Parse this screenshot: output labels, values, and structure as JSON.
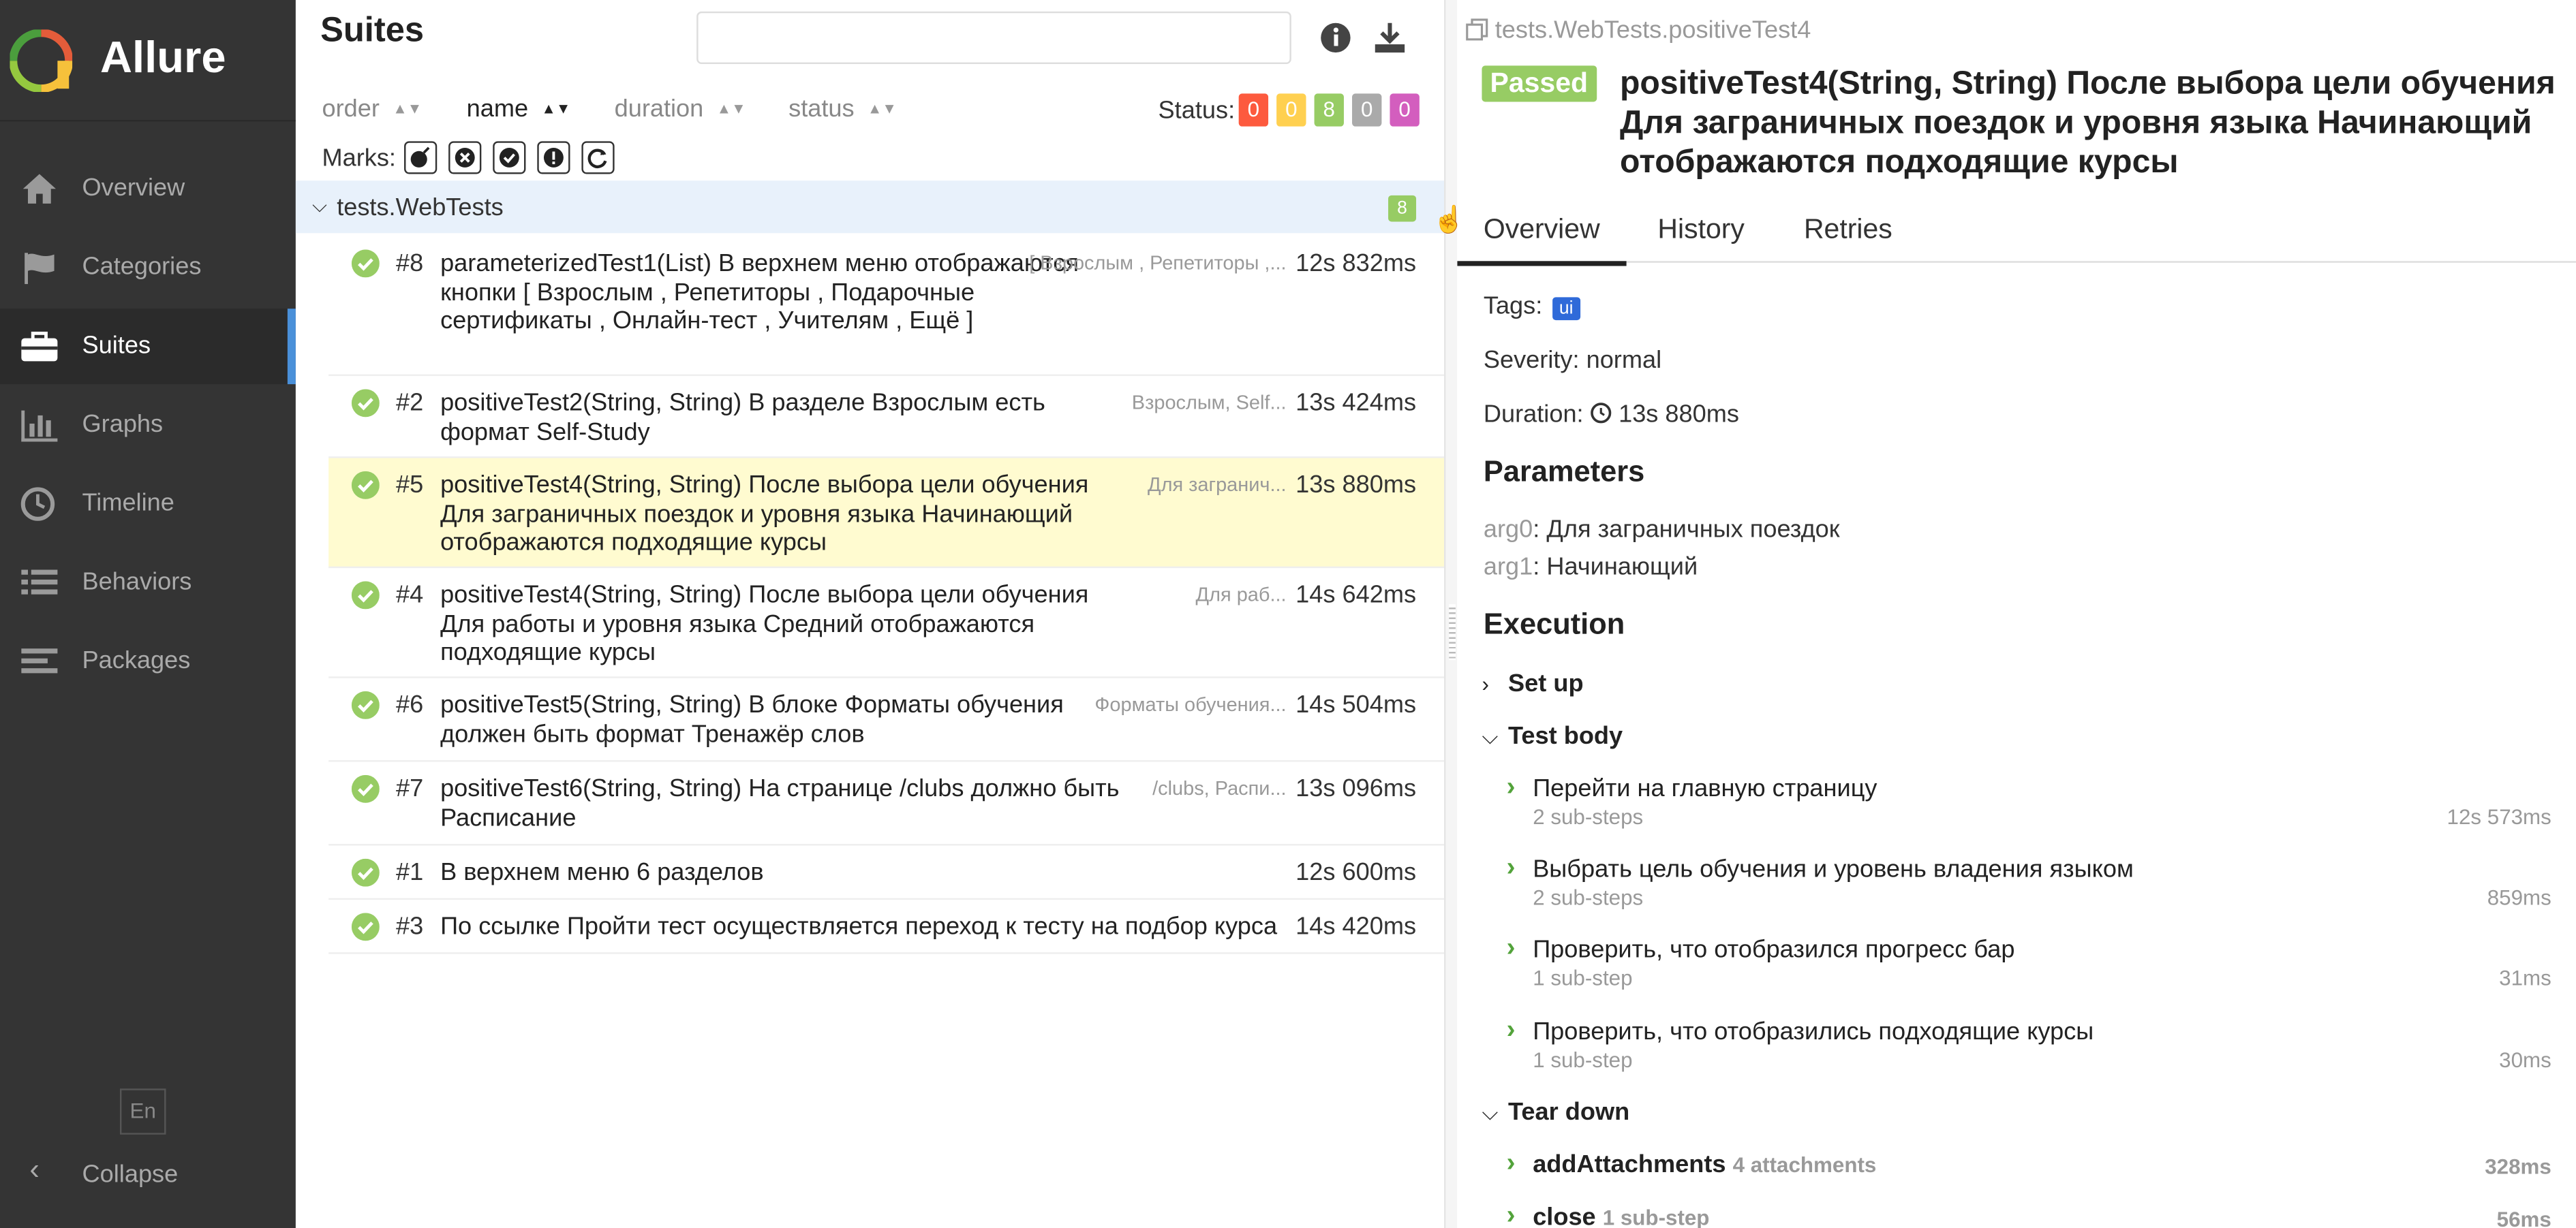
{
  "app": {
    "name": "Allure"
  },
  "sidebar": {
    "items": [
      {
        "label": "Overview",
        "icon": "home-icon"
      },
      {
        "label": "Categories",
        "icon": "flag-icon"
      },
      {
        "label": "Suites",
        "icon": "briefcase-icon",
        "active": true
      },
      {
        "label": "Graphs",
        "icon": "bar-chart-icon"
      },
      {
        "label": "Timeline",
        "icon": "clock-icon"
      },
      {
        "label": "Behaviors",
        "icon": "list-icon"
      },
      {
        "label": "Packages",
        "icon": "align-left-icon"
      }
    ],
    "language": "En",
    "collapse_label": "Collapse"
  },
  "suites": {
    "title": "Suites",
    "search_value": "",
    "sort": {
      "order": "order",
      "name": "name",
      "duration": "duration",
      "status": "status"
    },
    "status_label": "Status:",
    "status_counts": [
      {
        "value": "0",
        "color": "#fd5a3e"
      },
      {
        "value": "0",
        "color": "#ffd050"
      },
      {
        "value": "8",
        "color": "#97cc64"
      },
      {
        "value": "0",
        "color": "#aaaaaa"
      },
      {
        "value": "0",
        "color": "#d35ebe"
      }
    ],
    "marks_label": "Marks:",
    "group": {
      "name": "tests.WebTests",
      "count": "8"
    },
    "rows": [
      {
        "num": "#8",
        "title": "parameterizedTest1(List) В верхнем меню отображаются кнопки [ Взрослым , Репетиторы , Подарочные сертификаты , Онлайн-тест , Учителям , Ещё ]",
        "params": "[ Взрослым , Репетиторы ,...",
        "duration": "12s 832ms"
      },
      {
        "num": "#2",
        "title": "positiveTest2(String, String) В разделе Взрослым есть формат Self-Study",
        "params": "Взрослым, Self...",
        "duration": "13s 424ms"
      },
      {
        "num": "#5",
        "title": "positiveTest4(String, String) После выбора цели обучения Для заграничных поездок и уровня языка Начинающий отображаются подходящие курсы",
        "params": "Для загранич...",
        "duration": "13s 880ms",
        "selected": true
      },
      {
        "num": "#4",
        "title": "positiveTest4(String, String) После выбора цели обучения Для работы и уровня языка Средний отображаются подходящие курсы",
        "params": "Для раб...",
        "duration": "14s 642ms"
      },
      {
        "num": "#6",
        "title": "positiveTest5(String, String) В блоке Форматы обучения должен быть формат Тренажёр слов",
        "params": "Форматы обучения...",
        "duration": "14s 504ms"
      },
      {
        "num": "#7",
        "title": "positiveTest6(String, String) На странице /clubs должно быть Расписание",
        "params": "/clubs, Распи...",
        "duration": "13s 096ms"
      },
      {
        "num": "#1",
        "title": "В верхнем меню 6 разделов",
        "params": "",
        "duration": "12s 600ms"
      },
      {
        "num": "#3",
        "title": "По ссылке Пройти тест осуществляется переход к тесту на подбор курса",
        "params": "",
        "duration": "14s 420ms"
      }
    ]
  },
  "detail": {
    "path": "tests.WebTests.positiveTest4",
    "status": "Passed",
    "title": "positiveTest4(String, String) После выбора цели обучения Для заграничных поездок и уровня языка Начинающий отображаются подходящие курсы",
    "tabs": [
      "Overview",
      "History",
      "Retries"
    ],
    "tags_label": "Tags:",
    "tag": "ui",
    "severity": "Severity: normal",
    "duration_label": "Duration:",
    "duration": "13s 880ms",
    "parameters_heading": "Parameters",
    "params": [
      {
        "key": "arg0",
        "value": ": Для заграничных поездок"
      },
      {
        "key": "arg1",
        "value": ": Начинающий"
      }
    ],
    "execution_heading": "Execution",
    "setup_label": "Set up",
    "body_label": "Test body",
    "steps": [
      {
        "name": "Перейти на главную страницу",
        "sub": "2 sub-steps",
        "duration": "12s 573ms"
      },
      {
        "name": "Выбрать цель обучения и уровень владения языком",
        "sub": "2 sub-steps",
        "duration": "859ms"
      },
      {
        "name": "Проверить, что отобразился прогресс бар",
        "sub": "1 sub-step",
        "duration": "31ms"
      },
      {
        "name": "Проверить, что отобразились подходящие курсы",
        "sub": "1 sub-step",
        "duration": "30ms"
      }
    ],
    "teardown_label": "Tear down",
    "teardown": [
      {
        "name": "addAttachments",
        "sub": "4 attachments",
        "duration": "328ms"
      },
      {
        "name": "close",
        "sub": "1 sub-step",
        "duration": "56ms"
      }
    ]
  }
}
